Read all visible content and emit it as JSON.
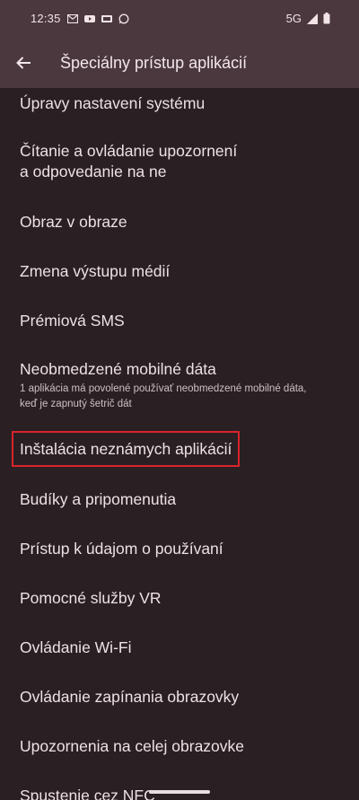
{
  "status": {
    "time": "12:35",
    "network": "5G",
    "icons": [
      "gmail-icon",
      "youtube-icon",
      "sd-card-icon",
      "whatsapp-icon",
      "signal-icon",
      "battery-icon"
    ]
  },
  "header": {
    "back_icon": "arrow-left-icon",
    "title": "Špeciálny prístup aplikácií"
  },
  "items": [
    {
      "label": "Úpravy nastavení systému"
    },
    {
      "label_line1": "Čítanie a ovládanie upozornení",
      "label_line2": "a odpovedanie na ne"
    },
    {
      "label": "Obraz v obraze"
    },
    {
      "label": "Zmena výstupu médií"
    },
    {
      "label": "Prémiová SMS"
    },
    {
      "label": "Neobmedzené mobilné dáta",
      "sub_line1": "1 aplikácia má povolené používať neobmedzené mobilné dáta,",
      "sub_line2": "keď je zapnutý šetrič dát"
    },
    {
      "label": "Inštalácia neznámych aplikácií"
    },
    {
      "label": "Budíky a pripomenutia"
    },
    {
      "label": "Prístup k údajom o používaní"
    },
    {
      "label": "Pomocné služby VR"
    },
    {
      "label": "Ovládanie Wi-Fi"
    },
    {
      "label": "Ovládanie zapínania obrazovky"
    },
    {
      "label": "Upozornenia na celej obrazovke"
    },
    {
      "label": "Spustenie cez NFC"
    }
  ],
  "colors": {
    "highlight": "#d8242b",
    "header_bg": "#4a383e",
    "page_bg": "#2a1f23"
  }
}
